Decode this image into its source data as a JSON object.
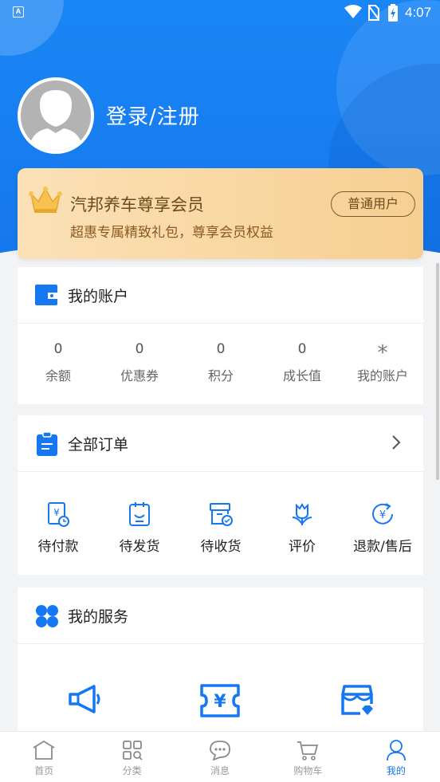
{
  "status_bar": {
    "notification_glyph": "A",
    "time": "4:07"
  },
  "profile": {
    "login_label": "登录/注册",
    "avatar_icon": "default-avatar-icon"
  },
  "vip": {
    "title": "汽邦养车尊享会员",
    "subtitle": "超惠专属精致礼包，尊享会员权益",
    "badge": "普通用户",
    "colors": {
      "card_start": "#fbe1b6",
      "card_end": "#f6cf92",
      "text": "#6b4a1e"
    }
  },
  "account": {
    "title": "我的账户",
    "stats": [
      {
        "value": "0",
        "label": "余额"
      },
      {
        "value": "0",
        "label": "优惠券"
      },
      {
        "value": "0",
        "label": "积分"
      },
      {
        "value": "0",
        "label": "成长值"
      },
      {
        "value": "*",
        "label": "我的账户"
      }
    ]
  },
  "orders": {
    "title": "全部订单",
    "items": [
      {
        "label": "待付款",
        "icon": "pending-payment-icon"
      },
      {
        "label": "待发货",
        "icon": "pending-shipment-icon"
      },
      {
        "label": "待收货",
        "icon": "pending-receipt-icon"
      },
      {
        "label": "评价",
        "icon": "review-icon"
      },
      {
        "label": "退款/售后",
        "icon": "refund-icon"
      }
    ]
  },
  "services": {
    "title": "我的服务",
    "items": [
      {
        "icon": "megaphone-icon"
      },
      {
        "icon": "coupon-yen-icon"
      },
      {
        "icon": "store-icon"
      }
    ]
  },
  "tabbar": {
    "items": [
      {
        "label": "首页",
        "icon": "home-icon"
      },
      {
        "label": "分类",
        "icon": "category-icon"
      },
      {
        "label": "消息",
        "icon": "message-icon"
      },
      {
        "label": "购物车",
        "icon": "cart-icon"
      },
      {
        "label": "我的",
        "icon": "user-icon",
        "active": true
      }
    ]
  },
  "theme": {
    "primary": "#1677f2",
    "background": "#f2f3f5",
    "inactive": "#999999"
  }
}
